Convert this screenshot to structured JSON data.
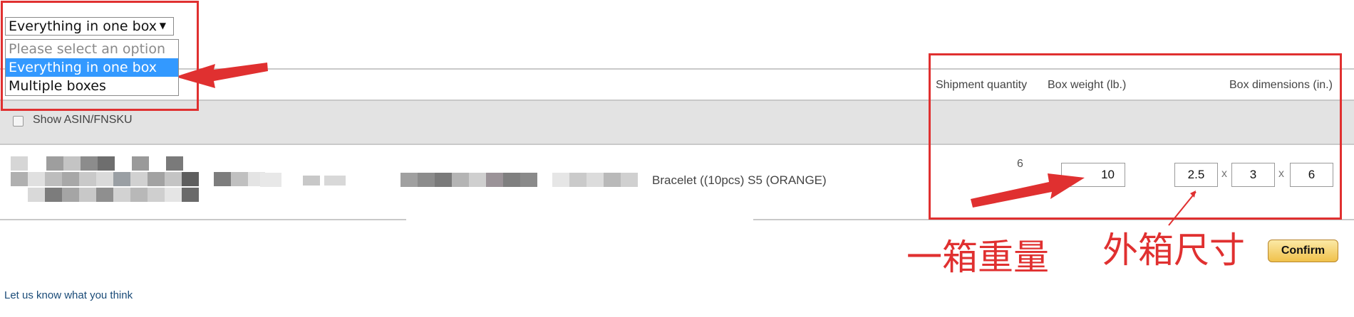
{
  "dropdown": {
    "selected": "Everything in one box",
    "options": [
      {
        "label": "Please select an option",
        "state": "placeholder"
      },
      {
        "label": "Everything in one box",
        "state": "highlighted"
      },
      {
        "label": "Multiple boxes",
        "state": "normal"
      }
    ]
  },
  "table": {
    "headers": {
      "shipment_quantity": "Shipment quantity",
      "box_weight": "Box weight (lb.)",
      "box_dimensions": "Box dimensions (in.)"
    },
    "show_asin_label": "Show ASIN/FNSKU",
    "row": {
      "product_name_visible": "Bracelet ((10pcs) S5 (ORANGE)",
      "quantity": "6",
      "weight": "10",
      "dim_length": "2.5",
      "dim_width": "3",
      "dim_height": "6",
      "dim_separator": "x"
    }
  },
  "annotations": {
    "weight_note": "一箱重量",
    "dimensions_note": "外箱尺寸",
    "color": "#e03030"
  },
  "actions": {
    "confirm_label": "Confirm"
  },
  "footer": {
    "feedback_link": "Let us know what you think"
  }
}
